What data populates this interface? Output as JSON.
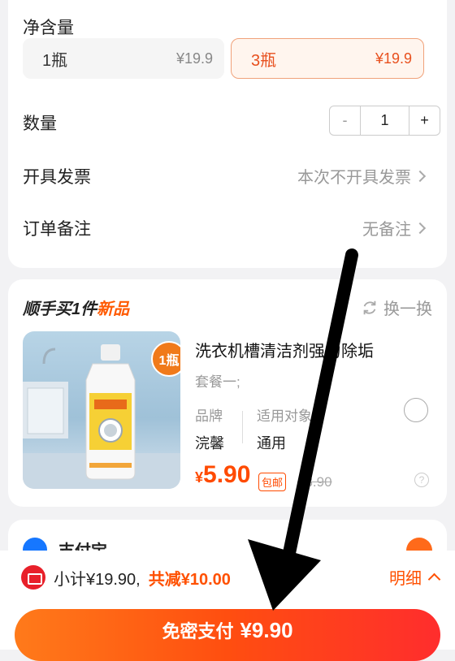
{
  "net_content": {
    "label": "净含量",
    "options": [
      {
        "name": "1瓶",
        "price": "¥19.9",
        "selected": false
      },
      {
        "name": "3瓶",
        "price": "¥19.9",
        "selected": true
      }
    ]
  },
  "quantity": {
    "label": "数量",
    "minus": "-",
    "value": "1",
    "plus": "+"
  },
  "invoice": {
    "label": "开具发票",
    "value": "本次不开具发票"
  },
  "note": {
    "label": "订单备注",
    "value": "无备注"
  },
  "upsell": {
    "title_prefix": "顺手买1件",
    "title_new": "新品",
    "swap_label": "换一换",
    "badge": "1瓶",
    "product_name": "洗衣机槽清洁剂强力除垢",
    "package": "套餐一;",
    "brand_label": "品牌",
    "brand_value": "浣馨",
    "target_label": "适用对象",
    "target_value": "通用",
    "price_symbol": "¥",
    "price": "5.90",
    "free_shipping": "包邮",
    "original_price": "13.90",
    "help": "?"
  },
  "payment_method": {
    "label": "支付宝"
  },
  "summary": {
    "subtotal": "小计¥19.90,",
    "discount": "共减¥10.00",
    "detail": "明细"
  },
  "pay_button": {
    "label": "免密支付",
    "amount": "¥9.90"
  },
  "colors": {
    "accent": "#ff5000",
    "price": "#ff4a00",
    "button_start": "#ff7a1a",
    "button_end": "#ff2d2d"
  }
}
